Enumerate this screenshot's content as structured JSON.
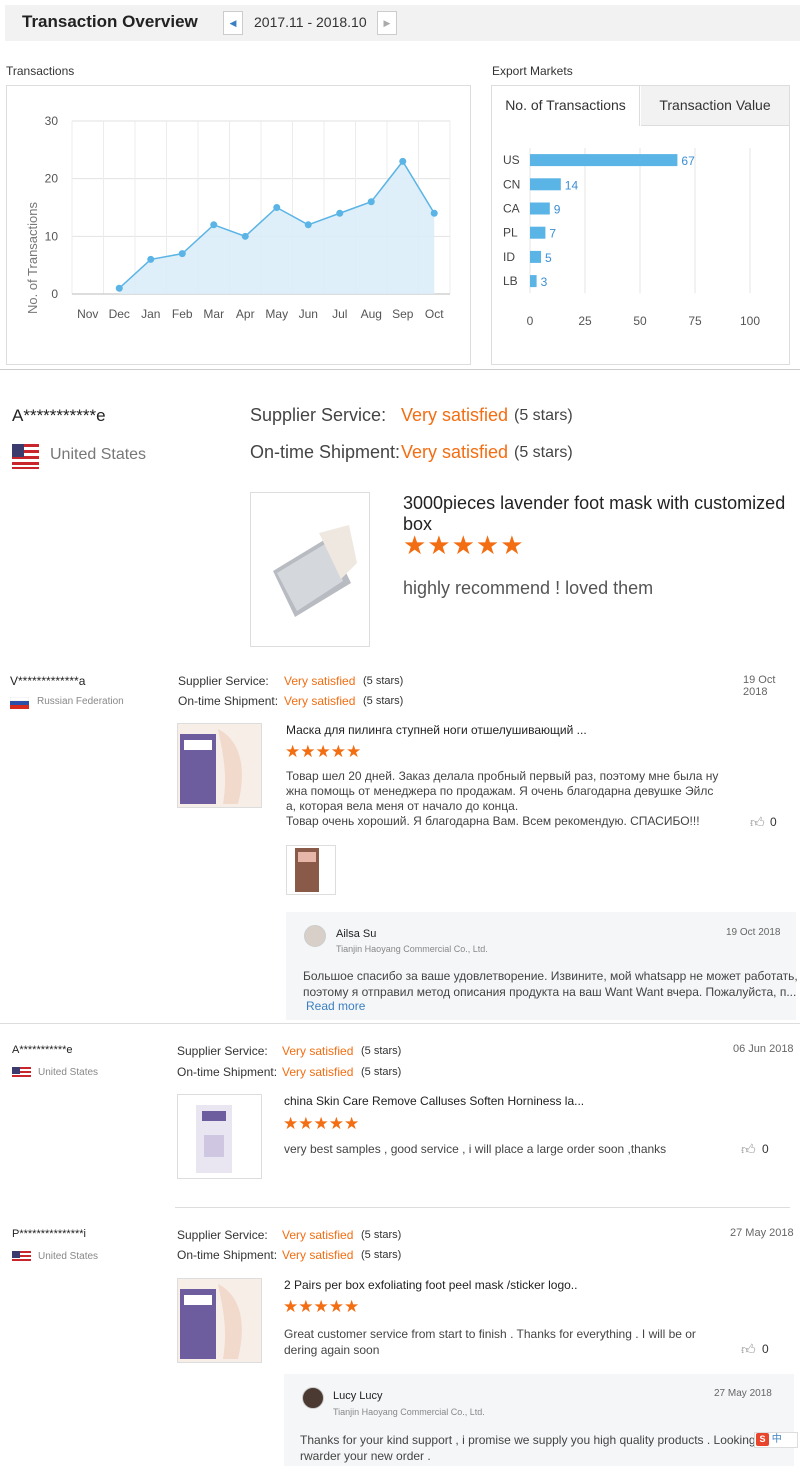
{
  "header": {
    "title": "Transaction Overview",
    "date_range": "2017.11 - 2018.10"
  },
  "transactions": {
    "label": "Transactions",
    "chart_data": {
      "type": "area",
      "title": "",
      "xlabel": "",
      "ylabel": "No. of Transactions",
      "categories": [
        "Nov",
        "Dec",
        "Jan",
        "Feb",
        "Mar",
        "Apr",
        "May",
        "Jun",
        "Jul",
        "Aug",
        "Sep",
        "Oct"
      ],
      "values": [
        null,
        1,
        6,
        7,
        12,
        10,
        15,
        12,
        14,
        16,
        23,
        14
      ],
      "ylim": [
        0,
        30
      ],
      "yticks": [
        0,
        10,
        20,
        30
      ],
      "grid": true,
      "color": "#5ab4e5"
    }
  },
  "export_markets": {
    "label": "Export Markets",
    "tabs": [
      "No. of Transactions",
      "Transaction Value"
    ],
    "chart_data": {
      "type": "bar",
      "orientation": "horizontal",
      "categories": [
        "US",
        "CN",
        "CA",
        "PL",
        "ID",
        "LB"
      ],
      "values": [
        67,
        14,
        9,
        7,
        5,
        3
      ],
      "xlim": [
        0,
        100
      ],
      "xticks": [
        0,
        25,
        50,
        75,
        100
      ],
      "color": "#5ab4e5"
    }
  },
  "featured_review": {
    "buyer": "A***********e",
    "country": "United States",
    "supplier_service_label": "Supplier Service:",
    "supplier_service_value": "Very satisfied",
    "supplier_service_stars": "(5 stars)",
    "shipment_label": "On-time Shipment:",
    "shipment_value": "Very satisfied",
    "shipment_stars": "(5 stars)",
    "product_title": "3000pieces lavender foot mask with customized box",
    "rating": 5,
    "comment": "highly recommend !  loved them"
  },
  "reviews": [
    {
      "buyer": "V*************a",
      "country": "Russian Federation",
      "date": "19 Oct 2018",
      "supplier_service_label": "Supplier Service:",
      "supplier_service_value": "Very satisfied",
      "supplier_service_stars": "(5 stars)",
      "shipment_label": "On-time Shipment:",
      "shipment_value": "Very satisfied",
      "shipment_stars": "(5 stars)",
      "product_title": "Маска для пилинга ступней ноги отшелушивающий ...",
      "rating": 5,
      "comment_lines": [
        "Товар шел 20 дней. Заказ делала пробный первый раз, поэтому мне была ну",
        "жна помощь от менеджера по продажам. Я очень благодарна девушке Эйлс",
        "а, которая вела меня от начало до конца.",
        "Товар очень хороший. Я благодарна Вам. Всем рекомендую. СПАСИБО!!!"
      ],
      "likes": "0",
      "reply": {
        "name": "Ailsa Su",
        "company": "Tianjin Haoyang Commercial Co., Ltd.",
        "date": "19 Oct 2018",
        "lines": [
          "Большое спасибо за ваше удовлетворение. Извините, мой whatsapp не может работать,",
          " поэтому я отправил метод описания продукта на ваш Want Want вчера. Пожалуйста, п..."
        ],
        "read_more": "Read more"
      }
    },
    {
      "buyer": "A***********e",
      "country": "United States",
      "date": "06 Jun 2018",
      "supplier_service_label": "Supplier Service:",
      "supplier_service_value": "Very satisfied",
      "supplier_service_stars": "(5 stars)",
      "shipment_label": "On-time Shipment:",
      "shipment_value": "Very satisfied",
      "shipment_stars": "(5 stars)",
      "product_title": "china Skin Care Remove Calluses Soften Horniness la...",
      "rating": 5,
      "comment_lines": [
        "very best samples ,  good service , i will place a  large order soon ,thanks"
      ],
      "likes": "0"
    },
    {
      "buyer": "P***************i",
      "country": "United States",
      "date": "27 May 2018",
      "supplier_service_label": "Supplier Service:",
      "supplier_service_value": "Very satisfied",
      "supplier_service_stars": "(5 stars)",
      "shipment_label": "On-time Shipment:",
      "shipment_value": "Very satisfied",
      "shipment_stars": "(5 stars)",
      "product_title": "2 Pairs per box exfoliating foot peel mask /sticker logo..",
      "rating": 5,
      "comment_lines": [
        "Great customer service from start to finish . Thanks for everything . I will be or",
        "dering again soon"
      ],
      "likes": "0",
      "reply": {
        "name": "Lucy Lucy",
        "company": "Tianjin Haoyang Commercial Co., Ltd.",
        "date": "27 May 2018",
        "lines": [
          "Thanks for your kind support ,  i promise we supply you high quality products .  Looking",
          "rwarder your new order ."
        ]
      }
    }
  ],
  "ime": {
    "label": "中"
  }
}
